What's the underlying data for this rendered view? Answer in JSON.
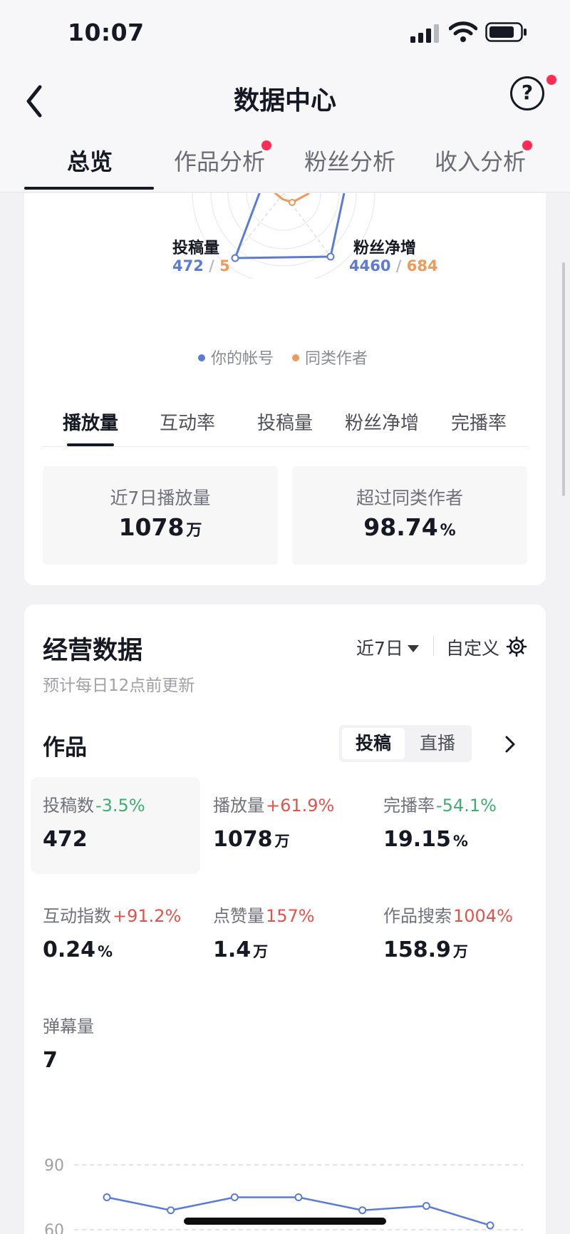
{
  "status_bar": {
    "time": "10:07"
  },
  "nav": {
    "title": "数据中心",
    "help_label": "?"
  },
  "top_tabs": [
    {
      "label": "总览",
      "active": true,
      "has_dot": false
    },
    {
      "label": "作品分析",
      "active": false,
      "has_dot": true
    },
    {
      "label": "粉丝分析",
      "active": false,
      "has_dot": false
    },
    {
      "label": "收入分析",
      "active": false,
      "has_dot": true
    }
  ],
  "benchmark": {
    "radar": {
      "left_axis": {
        "label": "投稿量",
        "mine": "472",
        "peer": "5"
      },
      "right_axis": {
        "label": "粉丝净增",
        "mine": "4460",
        "peer": "684"
      },
      "separator": "/"
    },
    "legend": {
      "mine": "你的帐号",
      "peer": "同类作者"
    },
    "metric_tabs": [
      "播放量",
      "互动率",
      "投稿量",
      "粉丝净增",
      "完播率"
    ],
    "active_metric_tab": 0,
    "stat_left": {
      "label": "近7日播放量",
      "value": "1078",
      "unit": "万"
    },
    "stat_right": {
      "label": "超过同类作者",
      "value": "98.74",
      "unit": "%"
    }
  },
  "ops": {
    "title": "经营数据",
    "subtitle": "预计每日12点前更新",
    "period": "近7日",
    "custom_label": "自定义",
    "works_title": "作品",
    "segments": [
      "投稿",
      "直播"
    ],
    "active_segment": 0,
    "metrics": [
      {
        "label": "投稿数",
        "change": "-3.5%",
        "dir": "down",
        "value": "472",
        "unit": ""
      },
      {
        "label": "播放量",
        "change": "+61.9%",
        "dir": "up",
        "value": "1078",
        "unit": "万"
      },
      {
        "label": "完播率",
        "change": "-54.1%",
        "dir": "down",
        "value": "19.15",
        "unit": "%"
      },
      {
        "label": "互动指数",
        "change": "+91.2%",
        "dir": "up",
        "value": "0.24",
        "unit": "%"
      },
      {
        "label": "点赞量",
        "change": "157%",
        "dir": "up",
        "value": "1.4",
        "unit": "万"
      },
      {
        "label": "作品搜索",
        "change": "1004%",
        "dir": "up",
        "value": "158.9",
        "unit": "万"
      },
      {
        "label": "弹幕量",
        "change": "",
        "dir": "",
        "value": "7",
        "unit": ""
      }
    ]
  },
  "chart_data": {
    "type": "line",
    "y_ticks": [
      "90",
      "60"
    ],
    "ylim": [
      60,
      90
    ],
    "values": [
      75,
      69,
      75,
      75,
      69,
      71,
      62
    ],
    "color": "#5b7bd5",
    "grid": "dashed"
  },
  "colors": {
    "mine": "#5b7bd5",
    "peer": "#ee9a5a",
    "accent_dot": "#fe2c55",
    "up": "#e2534a",
    "down": "#3fae70"
  }
}
